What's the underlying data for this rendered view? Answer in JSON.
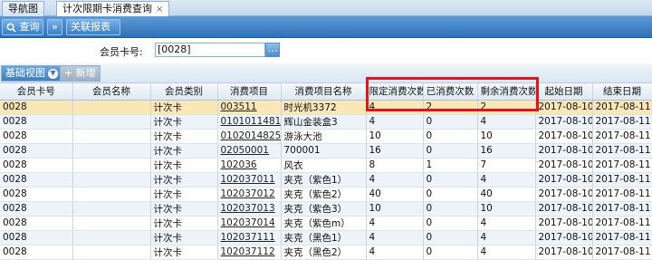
{
  "tabs": [
    {
      "label": "导航图"
    },
    {
      "label": "计次限期卡消费查询",
      "close": "×"
    }
  ],
  "toolbar": {
    "query_label": "查询",
    "collapse_symbol": "»",
    "export_label": "关联报表"
  },
  "search": {
    "label": "会员卡号:",
    "value": "[0028]",
    "button": "…"
  },
  "views": {
    "basic_view": "基础视图",
    "new_label": "+ 新增"
  },
  "table": {
    "headers": [
      "会员卡号",
      "会员名称",
      "会员类别",
      "消费项目",
      "消费项目名称",
      "限定消费次数",
      "已消费次数",
      "剩余消费次数",
      "起始日期",
      "结束日期"
    ],
    "rows": [
      [
        "0028",
        "",
        "计次卡",
        "003511",
        "时光机3372",
        "4",
        "2",
        "2",
        "2017-08-10",
        "2017-08-11"
      ],
      [
        "0028",
        "",
        "计次卡",
        "0101011481",
        "辉山金装盒3",
        "4",
        "0",
        "4",
        "2017-08-10",
        "2017-08-11"
      ],
      [
        "0028",
        "",
        "计次卡",
        "0102014825",
        "游泳大池",
        "10",
        "0",
        "10",
        "2017-08-10",
        "2017-08-11"
      ],
      [
        "0028",
        "",
        "计次卡",
        "02050001",
        "700001",
        "16",
        "0",
        "16",
        "2017-08-10",
        "2017-08-11"
      ],
      [
        "0028",
        "",
        "计次卡",
        "102036",
        "风衣",
        "8",
        "1",
        "7",
        "2017-08-10",
        "2017-08-11"
      ],
      [
        "0028",
        "",
        "计次卡",
        "102037011",
        "夹克（紫色1）",
        "4",
        "0",
        "4",
        "2017-08-10",
        "2017-08-11"
      ],
      [
        "0028",
        "",
        "计次卡",
        "102037012",
        "夹克（紫色2）",
        "40",
        "0",
        "40",
        "2017-08-10",
        "2017-08-11"
      ],
      [
        "0028",
        "",
        "计次卡",
        "102037013",
        "夹克（紫色3）",
        "10",
        "0",
        "10",
        "2017-08-10",
        "2017-08-11"
      ],
      [
        "0028",
        "",
        "计次卡",
        "102037014",
        "夹克（紫色m）",
        "4",
        "0",
        "4",
        "2017-08-10",
        "2017-08-11"
      ],
      [
        "0028",
        "",
        "计次卡",
        "102037111",
        "夹克（黑色1）",
        "4",
        "0",
        "4",
        "2017-08-10",
        "2017-08-11"
      ],
      [
        "0028",
        "",
        "计次卡",
        "102037112",
        "夹克（黑色2）",
        "4",
        "0",
        "4",
        "2017-08-10",
        "2017-08-11"
      ]
    ]
  },
  "colors": {
    "highlight_row": "#fbe6b6",
    "annotation_box": "#e0141c",
    "toolbar": "#2f72b8"
  }
}
